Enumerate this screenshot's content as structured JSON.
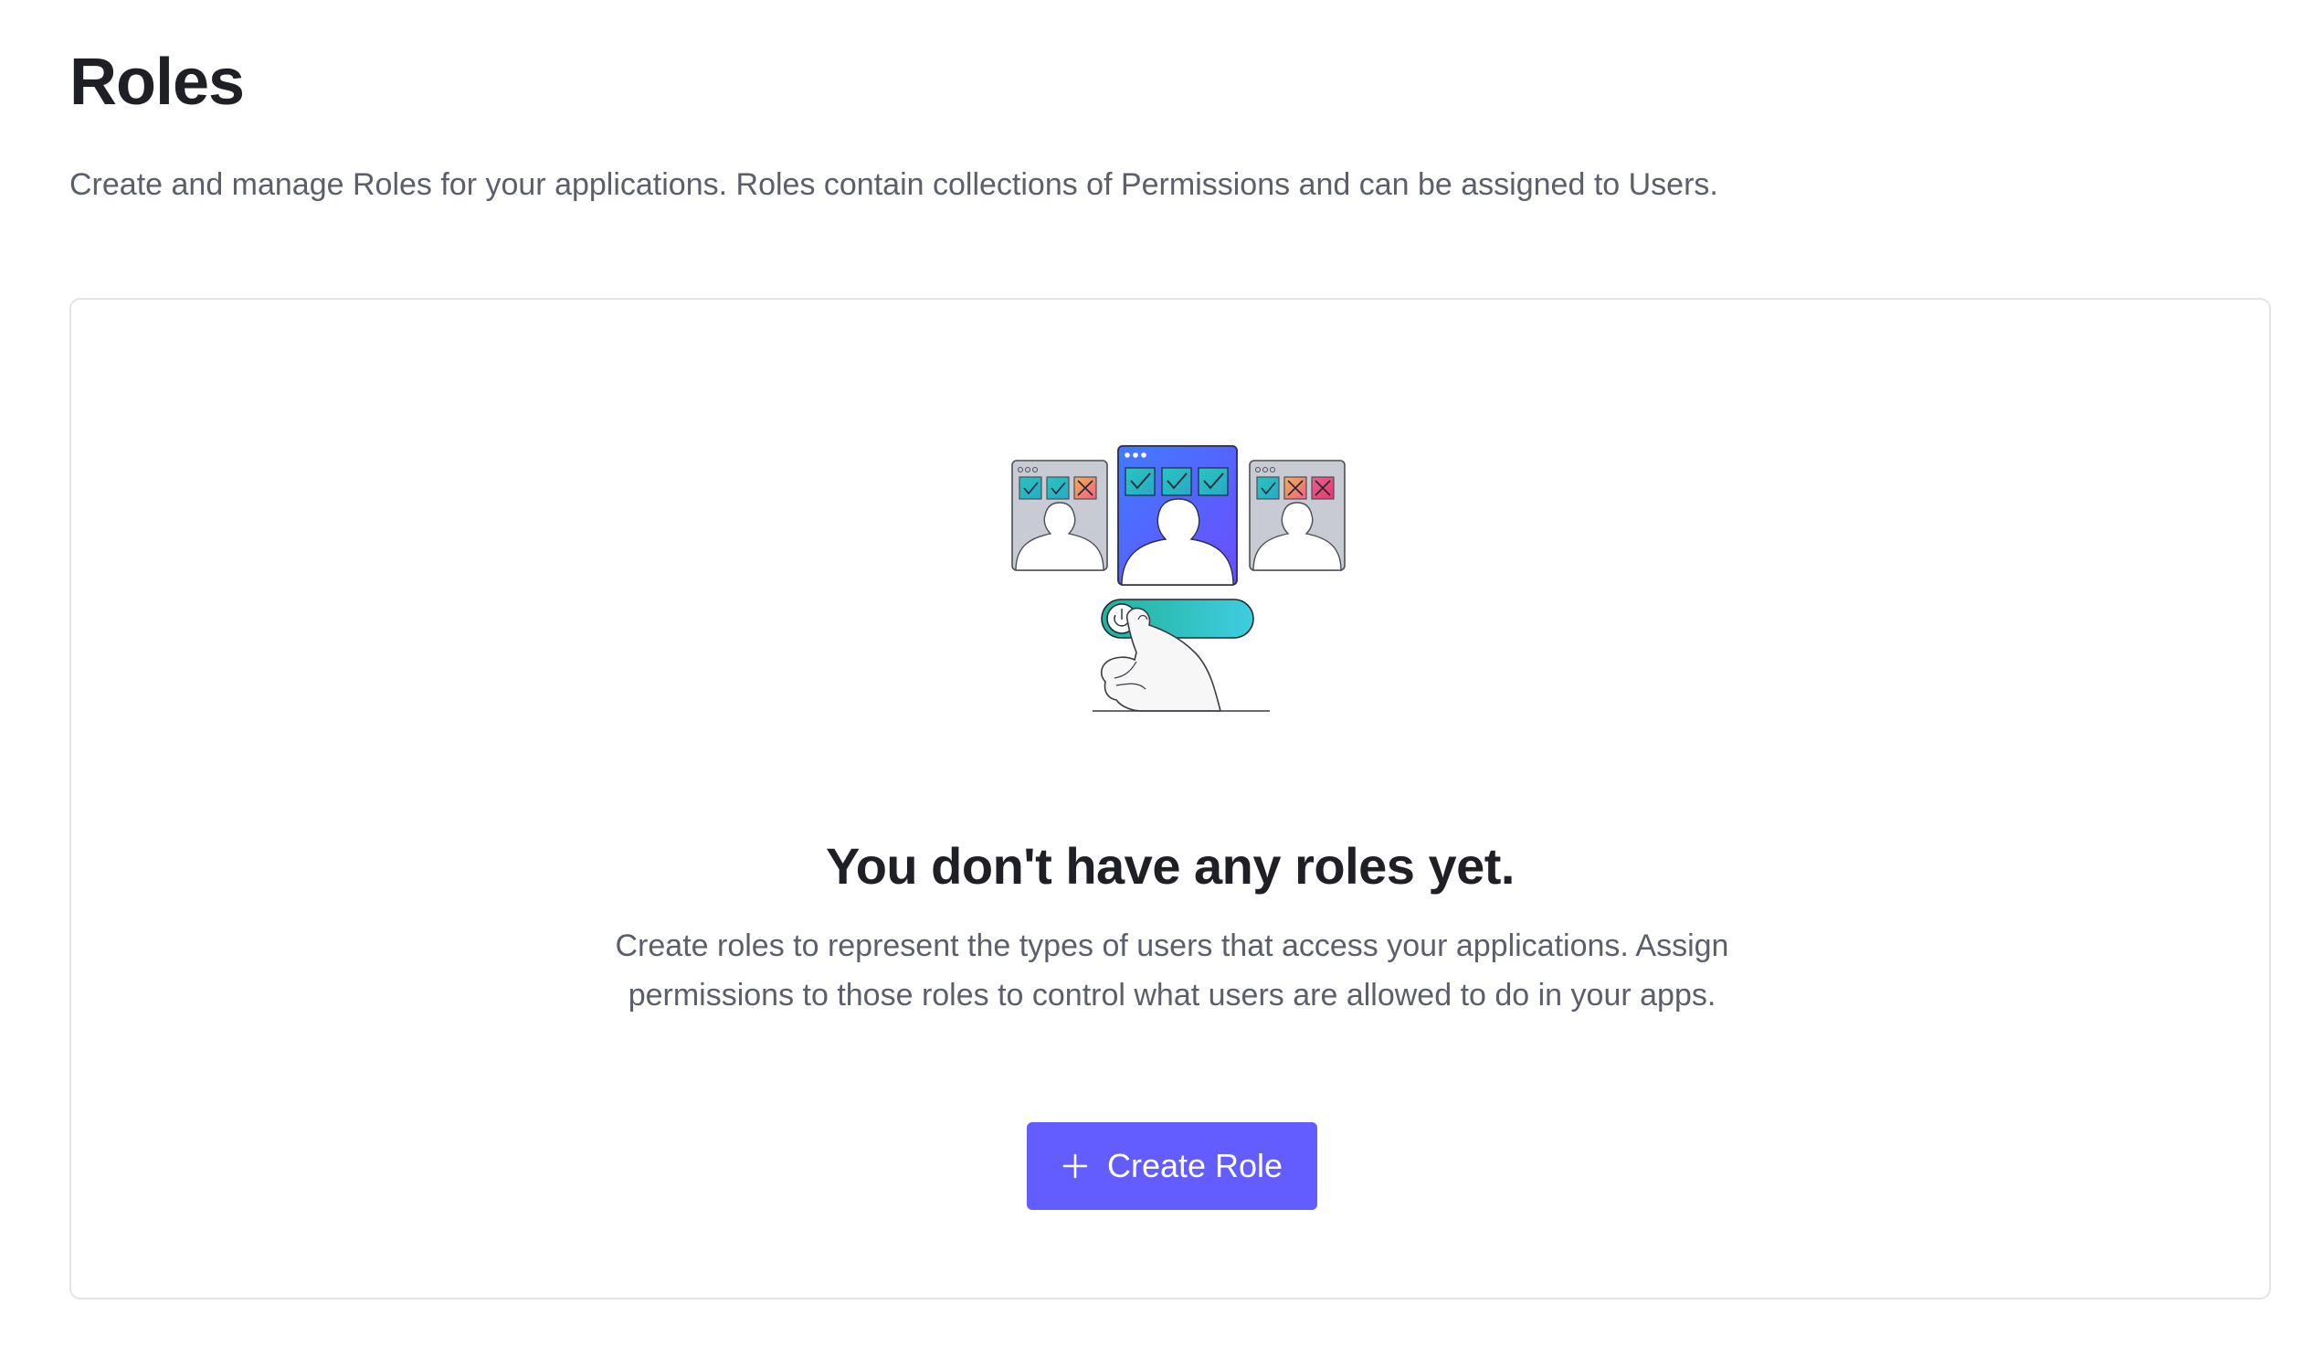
{
  "header": {
    "title": "Roles",
    "description": "Create and manage Roles for your applications. Roles contain collections of Permissions and can be assigned to Users."
  },
  "empty_state": {
    "illustration": "roles-toggle-illustration",
    "title": "You don't have any roles yet.",
    "text": "Create roles to represent the types of users that access your applications. Assign permissions to those roles to control what users are allowed to do in your apps.",
    "button": {
      "label": "Create Role",
      "icon": "plus-icon"
    }
  },
  "colors": {
    "accent": "#635dff",
    "title": "#1f1f26",
    "muted_text": "#5b5f6b",
    "card_border": "#e3e4e8",
    "check_teal": "#2ec4b6",
    "cross_orange": "#f08a5d",
    "cross_pink": "#f0518a"
  }
}
